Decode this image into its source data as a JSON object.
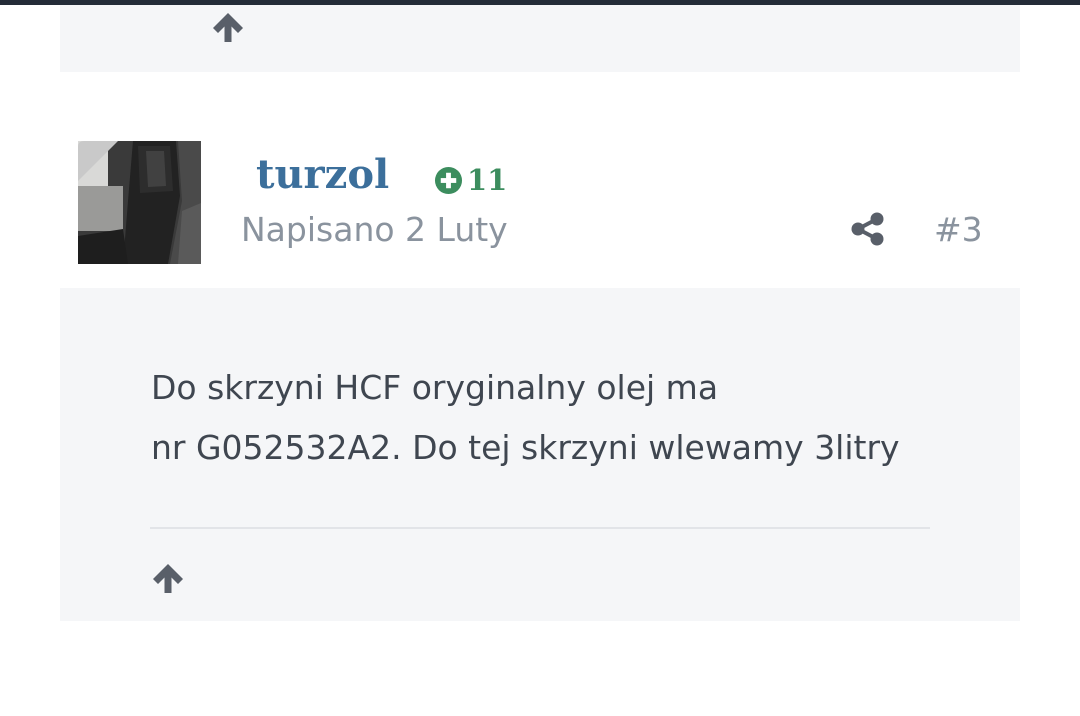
{
  "previous_post": {
    "up_icon": "arrow-up-icon"
  },
  "post": {
    "author": "turzol",
    "reputation": {
      "icon": "plus-circle-icon",
      "count": "11",
      "color": "#3c8d5e"
    },
    "date_text": "Napisano 2 Luty",
    "share_icon": "share-icon",
    "number": "#3",
    "content": {
      "line1": "Do skrzyni HCF oryginalny olej ma",
      "line2": "nr G052532A2. Do tej skrzyni wlewamy 3litry"
    },
    "up_icon": "arrow-up-icon"
  },
  "colors": {
    "author": "#3c6f9b",
    "meta_text": "#8a939e",
    "body_text": "#3f4650",
    "panel_bg": "#f5f6f8",
    "icon": "#595f69",
    "top_bar": "#242c38"
  }
}
